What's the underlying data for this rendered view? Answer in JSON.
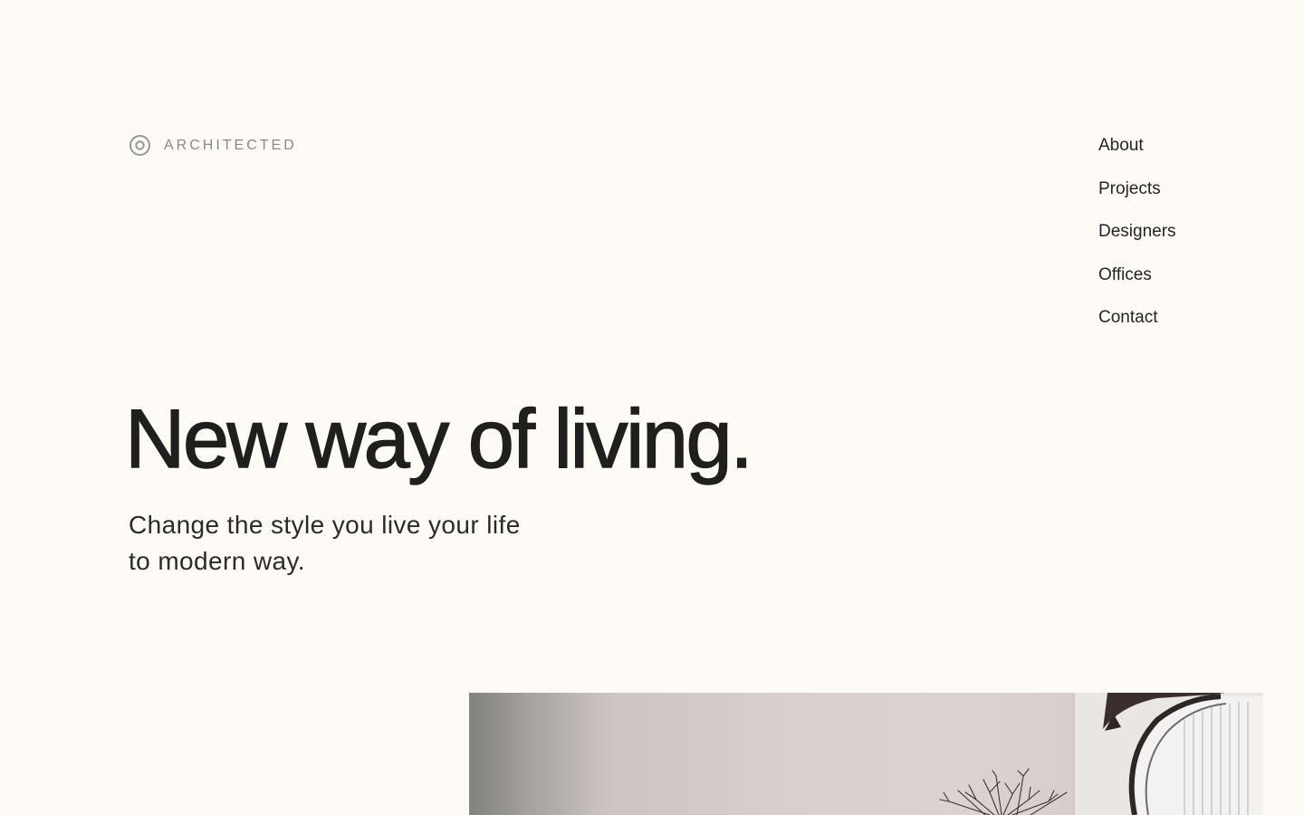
{
  "brand": {
    "name": "ARCHITECTED",
    "icon": "target-circle-icon"
  },
  "nav": {
    "items": [
      {
        "label": "About"
      },
      {
        "label": "Projects"
      },
      {
        "label": "Designers"
      },
      {
        "label": "Offices"
      },
      {
        "label": "Contact"
      }
    ]
  },
  "hero": {
    "title": "New way of living.",
    "subtitle_line1": "Change the style you live your life",
    "subtitle_line2": "to modern way.",
    "image": "interior-photo"
  },
  "colors": {
    "background": "#fefbf6",
    "text": "#1f1f1d",
    "muted": "#8a8784"
  }
}
